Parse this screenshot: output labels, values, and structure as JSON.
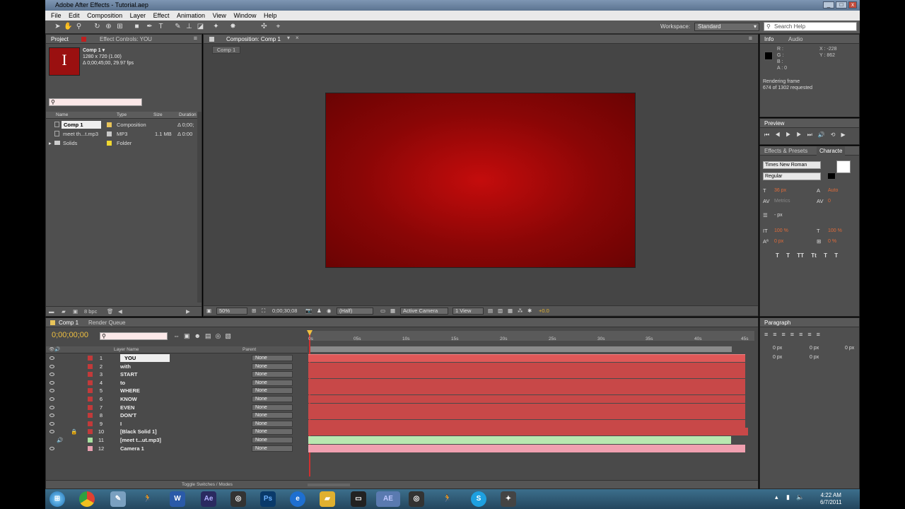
{
  "window": {
    "title": "Adobe After Effects - Tutorial.aep"
  },
  "menu": [
    "File",
    "Edit",
    "Composition",
    "Layer",
    "Effect",
    "Animation",
    "View",
    "Window",
    "Help"
  ],
  "toolbar": {
    "workspace_label": "Workspace:",
    "workspace_value": "Standard",
    "search_placeholder": "Search Help"
  },
  "project": {
    "tab": "Project",
    "effect_tab": "Effect Controls: YOU",
    "thumb_letter": "I",
    "info": [
      "Comp 1 ▾",
      "1280 x 720 (1.00)",
      "Δ 0;00;45;00, 29.97 fps"
    ],
    "columns": {
      "name": "Name",
      "type": "Type",
      "size": "Size",
      "duration": "Duration"
    },
    "items": [
      {
        "name": "Comp 1",
        "type": "Composition",
        "size": "",
        "duration": "Δ 0;00;",
        "color": "#e8c45a"
      },
      {
        "name": "meet th...t.mp3",
        "type": "MP3",
        "size": "1.1 MB",
        "duration": "Δ 0:00",
        "color": "#c9c9c9"
      },
      {
        "name": "Solids",
        "type": "Folder",
        "size": "",
        "duration": "",
        "color": "#f0d830"
      }
    ],
    "bpc": "8 bpc"
  },
  "composition": {
    "tab": "Composition: Comp 1",
    "subtab": "Comp 1",
    "zoom": "50%",
    "time": "0;00;30;08",
    "resolution": "(Half)",
    "camera": "Active Camera",
    "view": "1 View",
    "exposure": "+0.0"
  },
  "info": {
    "tab": "Info",
    "audio_tab": "Audio",
    "r": "R :",
    "g": "G :",
    "b": "B :",
    "a": "A : 0",
    "x": "X : -228",
    "y": "Y : 862",
    "status1": "Rendering frame",
    "status2": "674 of 1302 requested"
  },
  "preview": {
    "tab": "Preview"
  },
  "effects": {
    "tab": "Effects & Presets",
    "char_tab": "Characte"
  },
  "character": {
    "font": "Times New Roman",
    "style": "Regular",
    "size": "36 px",
    "leading": "Auto",
    "kerning": "Metrics",
    "tracking": "0",
    "stroke": "- px",
    "vscale": "100 %",
    "hscale": "100 %",
    "baseline": "0 px",
    "tsume": "0 %",
    "styles": [
      "T",
      "T",
      "TT",
      "Tt",
      "T",
      "T"
    ]
  },
  "paragraph": {
    "tab": "Paragraph",
    "v1": "0 px",
    "v2": "0 px",
    "v3": "0 px",
    "v4": "0 px",
    "v5": "0 px"
  },
  "timeline": {
    "tab": "Comp 1",
    "render_tab": "Render Queue",
    "timecode": "0;00;00;00",
    "layer_name_header": "Layer Name",
    "parent_header": "Parent",
    "toggle": "Toggle Switches / Modes",
    "ruler": [
      "0s",
      "05s",
      "10s",
      "15s",
      "20s",
      "25s",
      "30s",
      "35s",
      "40s",
      "45s"
    ],
    "layers": [
      {
        "num": "1",
        "name": "YOU",
        "parent": "None",
        "color": "#c23a3a"
      },
      {
        "num": "2",
        "name": "with",
        "parent": "None",
        "color": "#c23a3a"
      },
      {
        "num": "3",
        "name": "START",
        "parent": "None",
        "color": "#c23a3a"
      },
      {
        "num": "4",
        "name": "to",
        "parent": "None",
        "color": "#c23a3a"
      },
      {
        "num": "5",
        "name": "WHERE",
        "parent": "None",
        "color": "#c23a3a"
      },
      {
        "num": "6",
        "name": "KNOW",
        "parent": "None",
        "color": "#c23a3a"
      },
      {
        "num": "7",
        "name": "EVEN",
        "parent": "None",
        "color": "#c23a3a"
      },
      {
        "num": "8",
        "name": "DON'T",
        "parent": "None",
        "color": "#c23a3a"
      },
      {
        "num": "9",
        "name": "I",
        "parent": "None",
        "color": "#c23a3a"
      },
      {
        "num": "10",
        "name": "[Black Solid 1]",
        "parent": "None",
        "color": "#c23a3a"
      },
      {
        "num": "11",
        "name": "[meet t...ut.mp3]",
        "parent": "None",
        "color": "#a8e0a0"
      },
      {
        "num": "12",
        "name": "Camera 1",
        "parent": "None",
        "color": "#e8a0b0"
      }
    ]
  },
  "clock": {
    "time": "4:22 AM",
    "date": "6/7/2011"
  },
  "taskbar": [
    "Chrome",
    "Paint",
    "Runner",
    "Word",
    "AE",
    "Steam",
    "Ps",
    "IE",
    "Folder",
    "Term",
    "AE",
    "Steam",
    "Runner",
    "Skype",
    "App"
  ]
}
